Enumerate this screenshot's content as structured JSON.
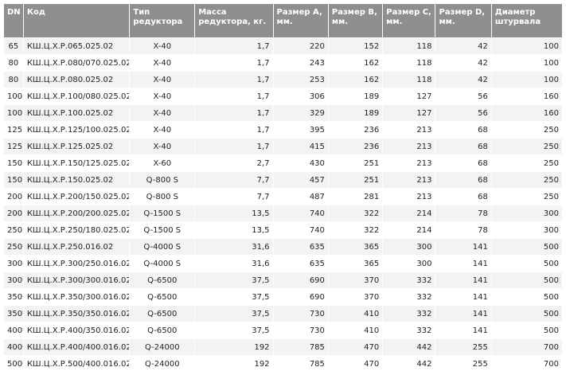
{
  "table": {
    "headers": [
      "DN",
      "Код",
      "Тип редуктора",
      "Масса редуктора, кг.",
      "Размер A, мм.",
      "Размер B, мм.",
      "Размер C, мм.",
      "Размер D, мм.",
      "Диаметр штурвала"
    ],
    "rows": [
      [
        "65",
        "КШ.Ц.Х.Р.065.025.02",
        "X-40",
        "1,7",
        "220",
        "152",
        "118",
        "42",
        "100"
      ],
      [
        "80",
        "КШ.Ц.Х.Р.080/070.025.02",
        "X-40",
        "1,7",
        "243",
        "162",
        "118",
        "42",
        "100"
      ],
      [
        "80",
        "КШ.Ц.Х.Р.080.025.02",
        "X-40",
        "1,7",
        "253",
        "162",
        "118",
        "42",
        "100"
      ],
      [
        "100",
        "КШ.Ц.Х.Р.100/080.025.02",
        "X-40",
        "1,7",
        "306",
        "189",
        "127",
        "56",
        "160"
      ],
      [
        "100",
        "КШ.Ц.Х.Р.100.025.02",
        "X-40",
        "1,7",
        "329",
        "189",
        "127",
        "56",
        "160"
      ],
      [
        "125",
        "КШ.Ц.Х.Р.125/100.025.02",
        "X-40",
        "1,7",
        "395",
        "236",
        "213",
        "68",
        "250"
      ],
      [
        "125",
        "КШ.Ц.Х.Р.125.025.02",
        "X-40",
        "1,7",
        "415",
        "236",
        "213",
        "68",
        "250"
      ],
      [
        "150",
        "КШ.Ц.Х.Р.150/125.025.02",
        "X-60",
        "2,7",
        "430",
        "251",
        "213",
        "68",
        "250"
      ],
      [
        "150",
        "КШ.Ц.Х.Р.150.025.02",
        "Q-800 S",
        "7,7",
        "457",
        "251",
        "213",
        "68",
        "250"
      ],
      [
        "200",
        "КШ.Ц.Х.Р.200/150.025.02",
        "Q-800 S",
        "7,7",
        "487",
        "281",
        "213",
        "68",
        "250"
      ],
      [
        "200",
        "КШ.Ц.Х.Р.200/200.025.02",
        "Q-1500 S",
        "13,5",
        "740",
        "322",
        "214",
        "78",
        "300"
      ],
      [
        "250",
        "КШ.Ц.Х.Р.250/180.025.02",
        "Q-1500 S",
        "13,5",
        "740",
        "322",
        "214",
        "78",
        "300"
      ],
      [
        "250*",
        "КШ.Ц.Х.Р.250.016.02",
        "Q-4000 S",
        "31,6",
        "635",
        "365",
        "300",
        "141",
        "500"
      ],
      [
        "300*",
        "КШ.Ц.Х.Р.300/250.016.02",
        "Q-4000 S",
        "31,6",
        "635",
        "365",
        "300",
        "141",
        "500"
      ],
      [
        "300*",
        "КШ.Ц.Х.Р.300/300.016.02",
        "Q-6500",
        "37,5",
        "690",
        "370",
        "332",
        "141",
        "500"
      ],
      [
        "350*",
        "КШ.Ц.Х.Р.350/300.016.02",
        "Q-6500",
        "37,5",
        "690",
        "370",
        "332",
        "141",
        "500"
      ],
      [
        "350*",
        "КШ.Ц.Х.Р.350/350.016.02",
        "Q-6500",
        "37,5",
        "730",
        "410",
        "332",
        "141",
        "500"
      ],
      [
        "400*",
        "КШ.Ц.Х.Р.400/350.016.02",
        "Q-6500",
        "37,5",
        "730",
        "410",
        "332",
        "141",
        "500"
      ],
      [
        "400*",
        "КШ.Ц.Х.Р.400/400.016.02",
        "Q-24000",
        "192",
        "785",
        "470",
        "442",
        "255",
        "700"
      ],
      [
        "500*",
        "КШ.Ц.Х.Р.500/400.016.02",
        "Q-24000",
        "192",
        "785",
        "470",
        "442",
        "255",
        "700"
      ]
    ]
  }
}
